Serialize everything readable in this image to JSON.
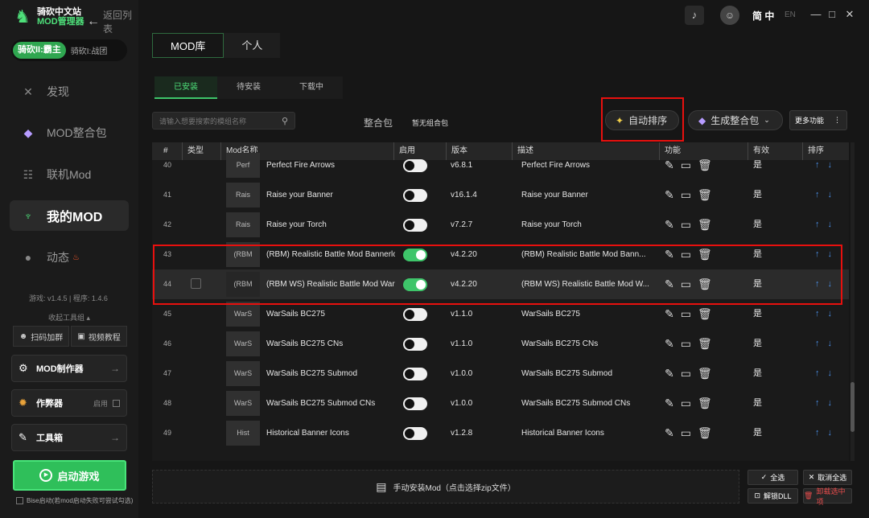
{
  "app": {
    "logo_line1": "骑砍中文站",
    "logo_line2": "MOD管理器",
    "back_label": "返回列表"
  },
  "game_switch": {
    "active": "骑砍II:霸主",
    "other": "骑砍I:战团"
  },
  "nav": [
    {
      "label": "发现",
      "icon": "discover-icon"
    },
    {
      "label": "MOD整合包",
      "icon": "diamond-icon"
    },
    {
      "label": "联机Mod",
      "icon": "network-icon"
    },
    {
      "label": "我的MOD",
      "icon": "trophy-icon"
    },
    {
      "label": "动态",
      "icon": "chat-icon"
    }
  ],
  "version_text": "游戏: v1.4.5 | 程序: 1.4.6",
  "collapse_label": "收起工具组 ▴",
  "tools": {
    "scan_group": "扫码加群",
    "video_tutorial": "视频教程",
    "mod_maker": "MOD制作器",
    "cheat": "作弊器",
    "cheat_enable": "启用",
    "toolbox": "工具箱"
  },
  "start_game": "启动游戏",
  "bise_text": "Bise启动(若mod启动失败可尝试勾选)",
  "header": {
    "lang_active": "简 中",
    "lang_other": "EN"
  },
  "tabs_primary": [
    "MOD库",
    "个人"
  ],
  "tabs_secondary": [
    "已安装",
    "待安装",
    "下载中"
  ],
  "search": {
    "placeholder": "请输入想要搜索的模组名称"
  },
  "pack": {
    "label": "整合包",
    "value": "暂无组合包"
  },
  "toolbar": {
    "auto_sort": "自动排序",
    "gen_pack": "生成整合包",
    "more": "更多功能"
  },
  "table": {
    "headers": [
      "#",
      "类型",
      "Mod名称",
      "启用",
      "版本",
      "描述",
      "功能",
      "有效",
      "排序"
    ],
    "rows": [
      {
        "num": "40",
        "tag": "Perf",
        "name": "Perfect Fire Arrows",
        "on": false,
        "ver": "v6.8.1",
        "desc": "Perfect Fire Arrows",
        "eff": "是"
      },
      {
        "num": "41",
        "tag": "Rais",
        "name": "Raise your Banner",
        "on": false,
        "ver": "v16.1.4",
        "desc": "Raise your Banner",
        "eff": "是"
      },
      {
        "num": "42",
        "tag": "Rais",
        "name": "Raise your Torch",
        "on": false,
        "ver": "v7.2.7",
        "desc": "Raise your Torch",
        "eff": "是"
      },
      {
        "num": "43",
        "tag": "(RBM",
        "name": "(RBM) Realistic Battle Mod Bannerlo",
        "on": true,
        "ver": "v4.2.20",
        "desc": "(RBM) Realistic Battle Mod Bann...",
        "eff": "是"
      },
      {
        "num": "44",
        "tag": "(RBM",
        "name": "(RBM WS) Realistic Battle Mod War S",
        "on": true,
        "ver": "v4.2.20",
        "desc": "(RBM WS) Realistic Battle Mod W...",
        "eff": "是"
      },
      {
        "num": "45",
        "tag": "WarS",
        "name": "WarSails BC275",
        "on": false,
        "ver": "v1.1.0",
        "desc": "WarSails BC275",
        "eff": "是"
      },
      {
        "num": "46",
        "tag": "WarS",
        "name": "WarSails BC275 CNs",
        "on": false,
        "ver": "v1.1.0",
        "desc": "WarSails BC275 CNs",
        "eff": "是"
      },
      {
        "num": "47",
        "tag": "WarS",
        "name": "WarSails BC275 Submod",
        "on": false,
        "ver": "v1.0.0",
        "desc": "WarSails BC275 Submod",
        "eff": "是"
      },
      {
        "num": "48",
        "tag": "WarS",
        "name": "WarSails BC275 Submod CNs",
        "on": false,
        "ver": "v1.0.0",
        "desc": "WarSails BC275 Submod CNs",
        "eff": "是"
      },
      {
        "num": "49",
        "tag": "Hist",
        "name": "Historical Banner Icons",
        "on": false,
        "ver": "v1.2.8",
        "desc": "Historical Banner Icons",
        "eff": "是"
      }
    ]
  },
  "install_label": "手动安装Mod（点击选择zip文件）",
  "bottom": {
    "select_all": "全选",
    "cancel_all": "取消全选",
    "unzip_dll": "解锁DLL",
    "uninstall": "卸载选中项"
  },
  "colors": {
    "accent": "#3ec56a",
    "highlight_box": "#e8100e",
    "sort_arrow": "#4a8fe8"
  }
}
